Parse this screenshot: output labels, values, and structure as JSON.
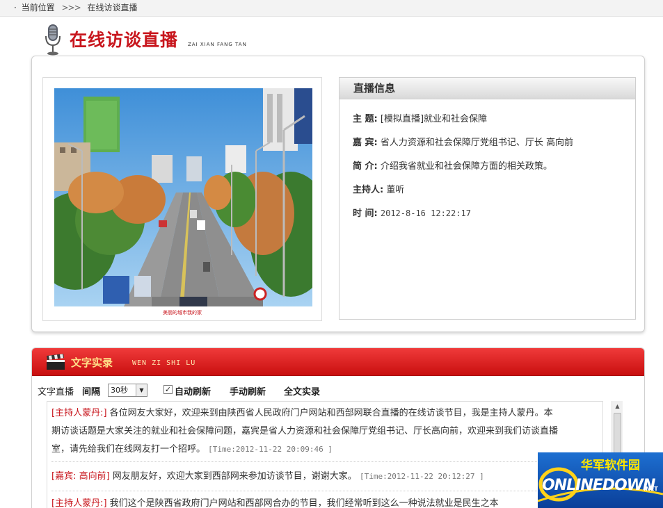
{
  "breadcrumb": {
    "bullet": "·",
    "location_label": "当前位置",
    "separator": ">>>",
    "current": "在线访谈直播"
  },
  "page_title": {
    "title": "在线访谈直播",
    "subtitle": "ZAI XIAN FANG TAN"
  },
  "photo": {
    "caption": "美丽的城市我的家"
  },
  "live_info": {
    "header": "直播信息",
    "rows": [
      {
        "key": "主  题:",
        "value": "[模拟直播]就业和社会保障"
      },
      {
        "key": "嘉  宾:",
        "value": "省人力资源和社会保障厅党组书记、厅长 高向前"
      },
      {
        "key": "简  介:",
        "value": "介绍我省就业和社会保障方面的相关政策。"
      },
      {
        "key": "主持人:",
        "value": "董听"
      },
      {
        "key": "时  间:",
        "value": "2012-8-16 12:22:17"
      }
    ]
  },
  "record": {
    "title": "文字实录",
    "subtitle": "WEN ZI SHI LU",
    "toolbar": {
      "live_label": "文字直播",
      "interval_label": "间隔",
      "interval_value": "30秒",
      "auto_refresh_label": "自动刷新",
      "auto_refresh_checked": true,
      "manual_refresh_label": "手动刷新",
      "full_record_label": "全文实录"
    },
    "messages": [
      {
        "speaker": "[主持人蒙丹:]",
        "lines": [
          "各位网友大家好，欢迎来到由陕西省人民政府门户网站和西部网联合直播的在线访谈节目，我是主持人蒙丹。本",
          "期访谈话题是大家关注的就业和社会保障问题，嘉宾是省人力资源和社会保障厅党组书记、厅长高向前，欢迎来到我们访谈直播",
          "室，请先给我们在线网友打一个招呼。"
        ],
        "time": "[Time:2012-11-22 20:09:46 ]"
      },
      {
        "speaker": "[嘉宾: 高向前]",
        "lines": [
          "网友朋友好，欢迎大家到西部网来参加访谈节目，谢谢大家。"
        ],
        "time": "[Time:2012-11-22 20:12:27 ]"
      },
      {
        "speaker": "[主持人蒙丹:]",
        "lines": [
          "我们这个是陕西省政府门户网站和西部网合办的节目，我们经常听到这么一种说法就业是民生之本"
        ],
        "time": ""
      }
    ]
  },
  "watermark": {
    "cn": "华军软件园",
    "en": "ONLINEDOWN",
    "suffix": ".NET"
  },
  "colors": {
    "accent_red": "#c8161d",
    "header_red": "#e02424",
    "record_title_yellow": "#ffe28a"
  }
}
